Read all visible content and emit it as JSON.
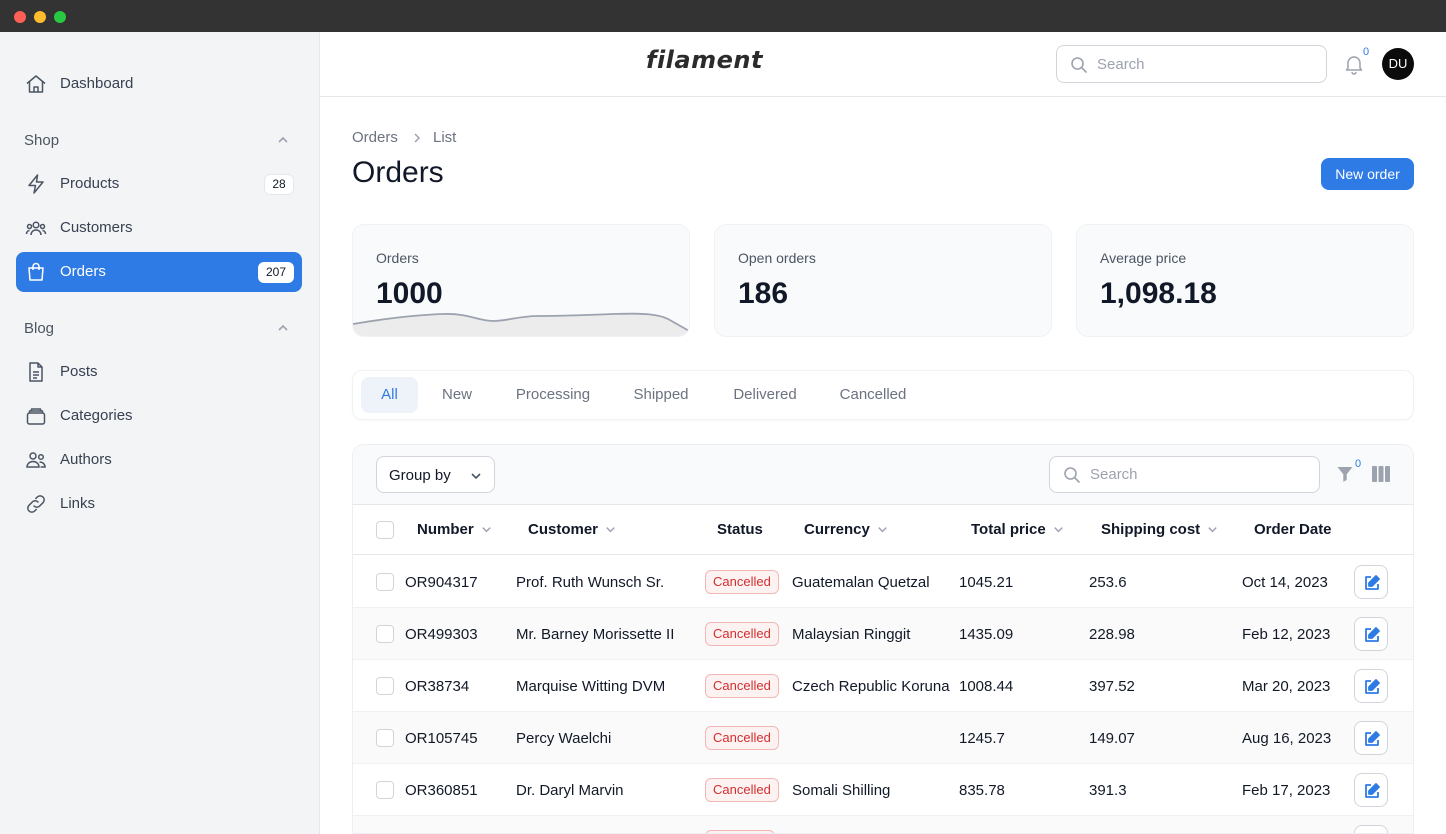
{
  "window": {
    "controls": [
      "close",
      "minimize",
      "maximize"
    ]
  },
  "brand": {
    "logo": "filament",
    "accent": "#2f7be5",
    "danger": "#d32f2f"
  },
  "topbar": {
    "search_placeholder": "Search",
    "notifications_count": "0",
    "avatar_initials": "DU"
  },
  "sidebar": {
    "dashboard": {
      "label": "Dashboard",
      "icon": "home-icon"
    },
    "groups": [
      {
        "label": "Shop",
        "items": [
          {
            "label": "Products",
            "badge": "28",
            "icon": "bolt-icon"
          },
          {
            "label": "Customers",
            "icon": "users-icon"
          },
          {
            "label": "Orders",
            "badge": "207",
            "icon": "shopping-bag-icon",
            "active": true
          }
        ]
      },
      {
        "label": "Blog",
        "items": [
          {
            "label": "Posts",
            "icon": "document-icon"
          },
          {
            "label": "Categories",
            "icon": "folder-stack-icon"
          },
          {
            "label": "Authors",
            "icon": "user-group-icon"
          },
          {
            "label": "Links",
            "icon": "link-icon"
          }
        ]
      }
    ]
  },
  "breadcrumb": {
    "items": [
      "Orders",
      "List"
    ]
  },
  "page": {
    "title": "Orders",
    "primary_action": "New order"
  },
  "stats": [
    {
      "label": "Orders",
      "value": "1000",
      "has_sparkline": true
    },
    {
      "label": "Open orders",
      "value": "186"
    },
    {
      "label": "Average price",
      "value": "1,098.18"
    }
  ],
  "tabs": [
    {
      "label": "All",
      "active": true
    },
    {
      "label": "New"
    },
    {
      "label": "Processing"
    },
    {
      "label": "Shipped"
    },
    {
      "label": "Delivered"
    },
    {
      "label": "Cancelled"
    }
  ],
  "table": {
    "group_by_label": "Group by",
    "search_placeholder": "Search",
    "filter_count": "0",
    "columns": [
      "Number",
      "Customer",
      "Status",
      "Currency",
      "Total price",
      "Shipping cost",
      "Order Date"
    ],
    "rows": [
      {
        "number": "OR904317",
        "customer": "Prof. Ruth Wunsch Sr.",
        "status": "Cancelled",
        "currency": "Guatemalan Quetzal",
        "total": "1045.21",
        "shipping": "253.6",
        "date": "Oct 14, 2023"
      },
      {
        "number": "OR499303",
        "customer": "Mr. Barney Morissette II",
        "status": "Cancelled",
        "currency": "Malaysian Ringgit",
        "total": "1435.09",
        "shipping": "228.98",
        "date": "Feb 12, 2023"
      },
      {
        "number": "OR38734",
        "customer": "Marquise Witting DVM",
        "status": "Cancelled",
        "currency": "Czech Republic Koruna",
        "total": "1008.44",
        "shipping": "397.52",
        "date": "Mar 20, 2023"
      },
      {
        "number": "OR105745",
        "customer": "Percy Waelchi",
        "status": "Cancelled",
        "currency": "",
        "total": "1245.7",
        "shipping": "149.07",
        "date": "Aug 16, 2023"
      },
      {
        "number": "OR360851",
        "customer": "Dr. Daryl Marvin",
        "status": "Cancelled",
        "currency": "Somali Shilling",
        "total": "835.78",
        "shipping": "391.3",
        "date": "Feb 17, 2023"
      }
    ]
  }
}
